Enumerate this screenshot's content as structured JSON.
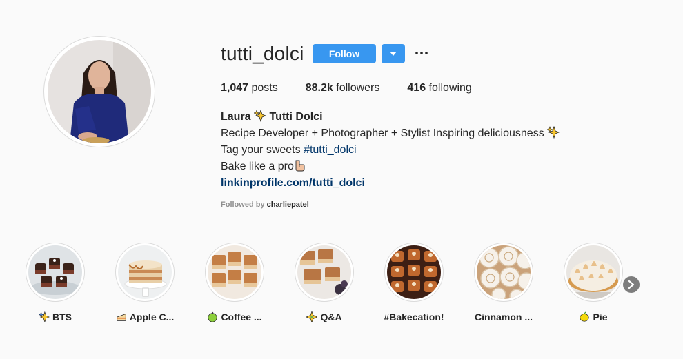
{
  "profile": {
    "username": "tutti_dolci",
    "follow_label": "Follow",
    "stats": {
      "posts_count": "1,047",
      "posts_label": "posts",
      "followers_count": "88.2k",
      "followers_label": "followers",
      "following_count": "416",
      "following_label": "following"
    },
    "bio": {
      "name_first": "Laura",
      "name_rest": "Tutti Dolci",
      "line1": "Recipe Developer + Photographer + Stylist Inspiring deliciousness",
      "line2_prefix": "Tag your sweets",
      "hashtag": "#tutti_dolci",
      "line3": "Bake like a pro",
      "link": "linkinprofile.com/tutti_dolci"
    },
    "followed_by_label": "Followed by",
    "followed_by_user": "charliepatel"
  },
  "highlights": [
    {
      "label": "BTS",
      "icon": "sparkles-icon"
    },
    {
      "label": "Apple C...",
      "icon": "cake-icon"
    },
    {
      "label": "Coffee ...",
      "icon": "green-apple-icon"
    },
    {
      "label": "Q&A",
      "icon": "sparkle-icon"
    },
    {
      "label": "#Bakecation!",
      "icon": ""
    },
    {
      "label": "Cinnamon ...",
      "icon": ""
    },
    {
      "label": "Pie",
      "icon": "lemon-icon"
    }
  ],
  "colors": {
    "accent": "#3897f0",
    "link": "#003569",
    "background": "#fafafa",
    "muted": "#8e8e8e"
  }
}
